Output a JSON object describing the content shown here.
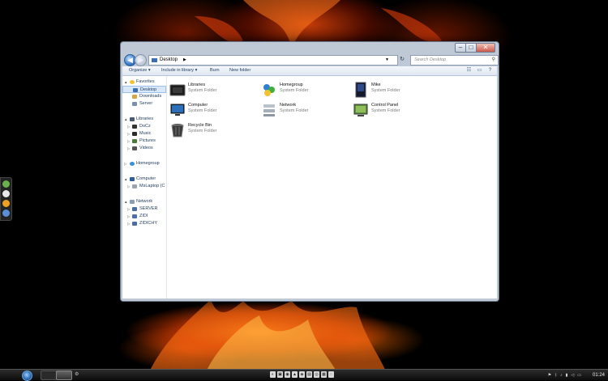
{
  "window": {
    "address": "Desktop",
    "search_placeholder": "Search Desktop",
    "caption": {
      "minimize": "–",
      "maximize": "□",
      "close": "✕"
    }
  },
  "toolbar": {
    "organize": "Organize ▾",
    "include": "Include in library ▾",
    "burn": "Burn",
    "new_folder": "New folder"
  },
  "nav": {
    "favorites": "Favorites",
    "desktop": "Desktop",
    "downloads": "Downloads",
    "server": "Server",
    "libraries": "Libraries",
    "docz": "DoCz",
    "music": "Music",
    "pictures": "Pictures",
    "videos": "Videos",
    "homegroup": "Homegroup",
    "computer": "Computer",
    "mslaptop": "MsLaptop (C",
    "network": "Network",
    "server2": "SERVER",
    "zidi": "ZIDI",
    "zidichy": "ZIDICHY"
  },
  "files": [
    {
      "name": "Libraries",
      "type": "System Folder",
      "icon": "libraries-icon"
    },
    {
      "name": "Homegroup",
      "type": "System Folder",
      "icon": "homegroup-icon"
    },
    {
      "name": "Mike",
      "type": "System Folder",
      "icon": "user-folder-icon"
    },
    {
      "name": "Computer",
      "type": "System Folder",
      "icon": "computer-icon"
    },
    {
      "name": "Network",
      "type": "System Folder",
      "icon": "network-icon"
    },
    {
      "name": "Control Panel",
      "type": "System Folder",
      "icon": "control-panel-icon"
    },
    {
      "name": "Recycle Bin",
      "type": "System Folder",
      "icon": "recycle-bin-icon"
    }
  ],
  "taskbar": {
    "clock": "01:24"
  },
  "colors": {
    "accent": "#3a7bc8",
    "selection": "#d8e7fa",
    "taskbar": "#111111"
  }
}
